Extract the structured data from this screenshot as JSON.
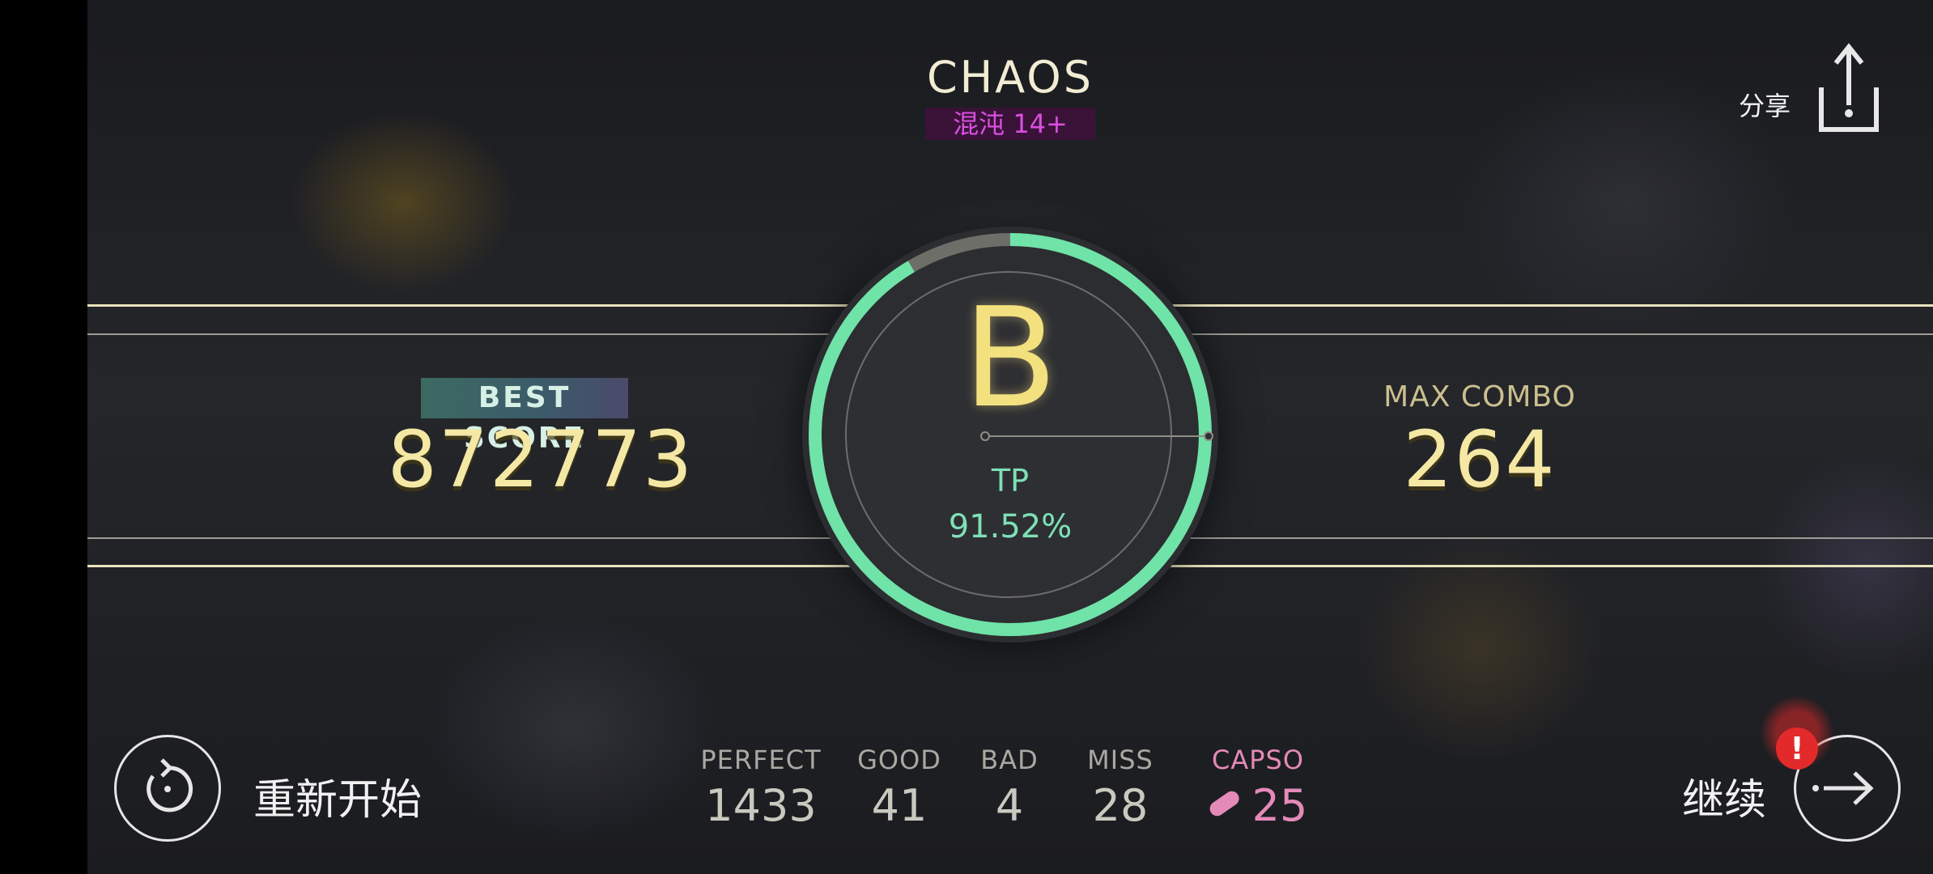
{
  "header": {
    "song_title": "CHAOS",
    "difficulty": "混沌 14+"
  },
  "share": {
    "label": "分享",
    "icon": "share-upload-icon"
  },
  "result": {
    "grade": "B",
    "tp_label": "TP",
    "tp_value": "91.52%",
    "tp_fraction": 0.9152
  },
  "best_score": {
    "label": "BEST SCORE",
    "value": "872773"
  },
  "max_combo": {
    "label": "MAX COMBO",
    "value": "264"
  },
  "judgements": [
    {
      "label": "PERFECT",
      "value": "1433"
    },
    {
      "label": "GOOD",
      "value": "41"
    },
    {
      "label": "BAD",
      "value": "4"
    },
    {
      "label": "MISS",
      "value": "28"
    }
  ],
  "capso": {
    "label": "CAPSO",
    "value": "25",
    "icon": "pill-icon"
  },
  "actions": {
    "restart_label": "重新开始",
    "continue_label": "继续",
    "alert_badge": "!"
  },
  "colors": {
    "accent_green": "#6fe3a8",
    "score_yellow": "#f5e8a4",
    "difficulty_purple": "#d94fe0",
    "capso_pink": "#e48ab8",
    "alert_red": "#e32a2a"
  }
}
